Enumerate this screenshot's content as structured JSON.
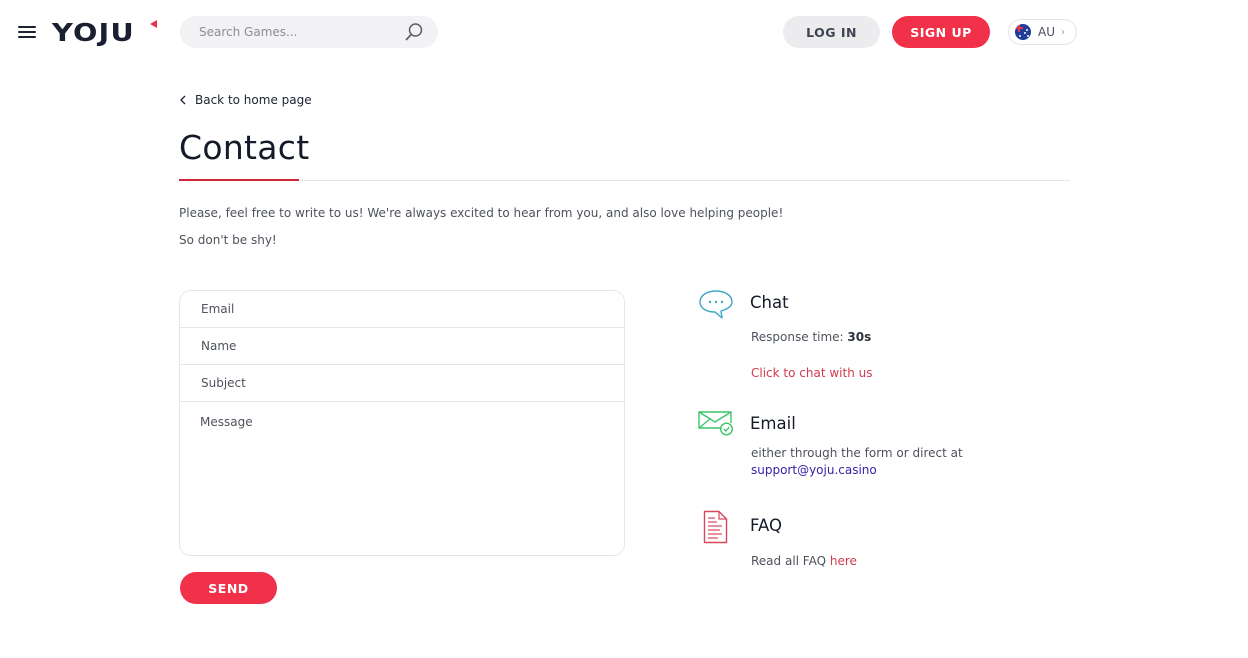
{
  "header": {
    "logo_text": "YOJU",
    "search_placeholder": "Search Games...",
    "login_label": "LOG IN",
    "signup_label": "SIGN UP",
    "language_code": "AU",
    "language_chevron": "›",
    "icons": {
      "menu": "hamburger-menu-icon",
      "search": "magnifier-icon",
      "flag": "australia-flag-icon"
    }
  },
  "page": {
    "back_label": "Back to home page",
    "title": "Contact",
    "intro_line1": "Please, feel free to write to us! We're always excited to hear from you, and also love helping people!",
    "intro_line2": "So don't be shy!"
  },
  "form": {
    "email_placeholder": "Email",
    "name_placeholder": "Name",
    "subject_placeholder": "Subject",
    "message_placeholder": "Message",
    "email_value": "",
    "name_value": "",
    "subject_value": "",
    "message_value": "",
    "send_label": "SEND"
  },
  "contact_options": {
    "chat": {
      "title": "Chat",
      "response_label": "Response time: ",
      "response_value": "30s",
      "link_label": "Click to chat with us",
      "icon": "chat-bubble-icon",
      "icon_color": "#3aa8c4"
    },
    "email": {
      "title": "Email",
      "text": "either through the form or direct at",
      "address": "support@yoju.casino",
      "icon": "envelope-check-icon",
      "icon_color": "#3cc46a"
    },
    "faq": {
      "title": "FAQ",
      "text": "Read all FAQ ",
      "link_label": "here",
      "icon": "document-icon",
      "icon_color": "#d8485c"
    }
  },
  "colors": {
    "accent_red": "#f1304a",
    "link_red": "#d23a4e",
    "link_blue": "#3a1ea8",
    "title_underline": "#d0283a"
  }
}
